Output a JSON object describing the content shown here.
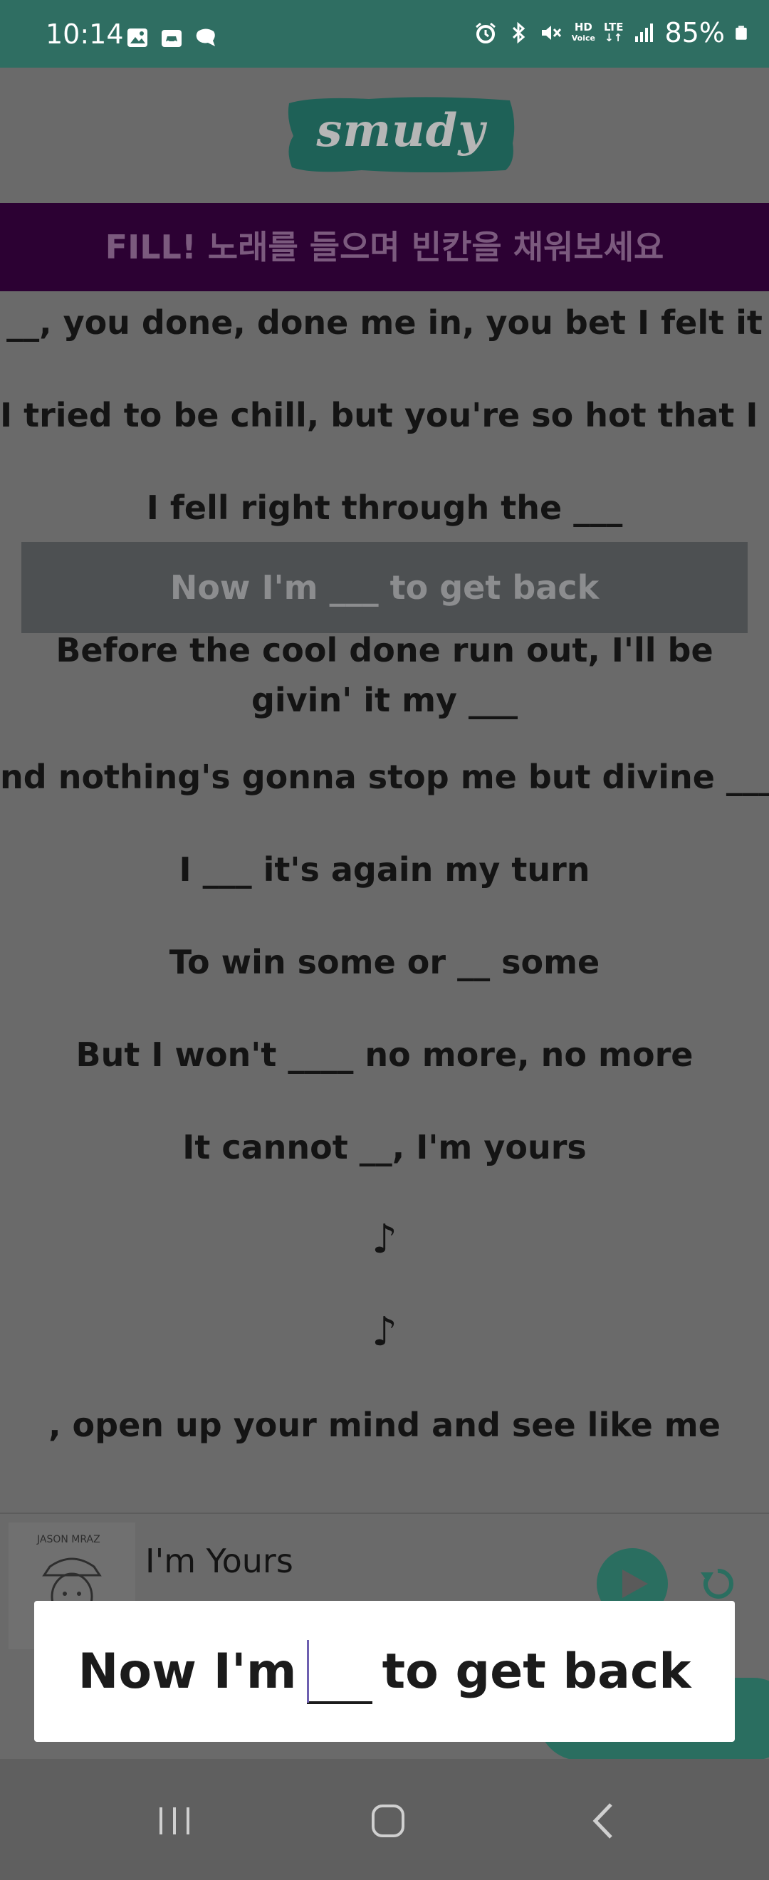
{
  "status_bar": {
    "time": "10:14",
    "battery": "85%",
    "network_top": "LTE",
    "hd_label": "HD",
    "hd_sub": "Voice"
  },
  "app": {
    "logo": "smudy",
    "banner": "FILL! 노래를 들으며 빈칸을 채워보세요",
    "brand_color": "#2a6e60",
    "banner_color": "#2c0133"
  },
  "lyrics": {
    "lines": [
      "__, you done, done me in, you bet I felt it",
      "I tried to be chill, but you're so hot that I ___",
      "I fell right through the ___",
      "Now I'm ___ to get back",
      "Before the cool done run out, I'll be givin' it my ___",
      "nd nothing's gonna stop me but divine ____",
      "I ___ it's again my turn",
      "To win some or __ some",
      "But I won't ____ no more, no more",
      "It cannot __, I'm yours",
      "♪",
      "♪",
      ", open up your mind and see like me"
    ],
    "current_index": 3
  },
  "player": {
    "song_title": "I'm Yours",
    "album_caption": "JASON MRAZ"
  },
  "answer_prompt": {
    "before": "Now I'm",
    "after": "to get back"
  }
}
